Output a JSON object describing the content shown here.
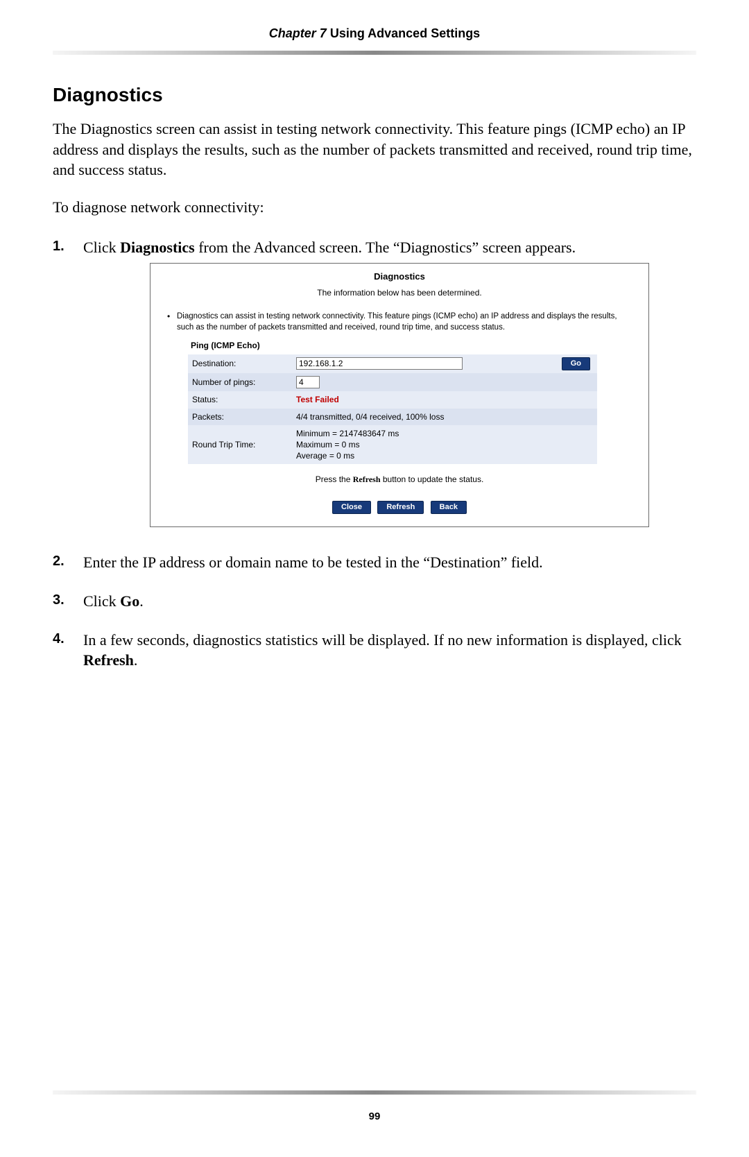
{
  "header": {
    "chapter_label": "Chapter 7",
    "chapter_title": "Using Advanced Settings"
  },
  "section_title": "Diagnostics",
  "intro_paragraph": "The Diagnostics screen can assist in testing network connectivity. This feature pings (ICMP echo) an IP address and displays the results, such as the number of packets transmitted and received, round trip time, and success status.",
  "instruction_line": "To diagnose network connectivity:",
  "steps": {
    "s1_pre": "Click ",
    "s1_bold": "Diagnostics",
    "s1_post": " from the Advanced screen. The “Diagnostics” screen appears.",
    "s2": "Enter the IP address or domain name to be tested in the “Destination” field.",
    "s3_pre": "Click ",
    "s3_bold": "Go",
    "s3_post": ".",
    "s4_pre": "In a few seconds, diagnostics statistics will be displayed. If no new information is displayed, click ",
    "s4_bold": "Refresh",
    "s4_post": "."
  },
  "panel": {
    "title": "Diagnostics",
    "subtitle": "The information below has been determined.",
    "note": "Diagnostics can assist in testing network connectivity. This feature pings (ICMP echo) an IP address and displays the results, such as the number of packets transmitted and received, round trip time, and success status.",
    "ping_heading": "Ping (ICMP Echo)",
    "rows": {
      "destination_label": "Destination:",
      "destination_value": "192.168.1.2",
      "go_label": "Go",
      "pings_label": "Number of pings:",
      "pings_value": "4",
      "status_label": "Status:",
      "status_value": "Test Failed",
      "packets_label": "Packets:",
      "packets_value": "4/4 transmitted, 0/4 received, 100% loss",
      "rtt_label": "Round Trip Time:",
      "rtt_line1": "Minimum = 2147483647 ms",
      "rtt_line2": "Maximum = 0 ms",
      "rtt_line3": "Average = 0 ms"
    },
    "refresh_note_pre": "Press the ",
    "refresh_note_bold": "Refresh",
    "refresh_note_post": " button to update the status.",
    "buttons": {
      "close": "Close",
      "refresh": "Refresh",
      "back": "Back"
    }
  },
  "page_number": "99"
}
